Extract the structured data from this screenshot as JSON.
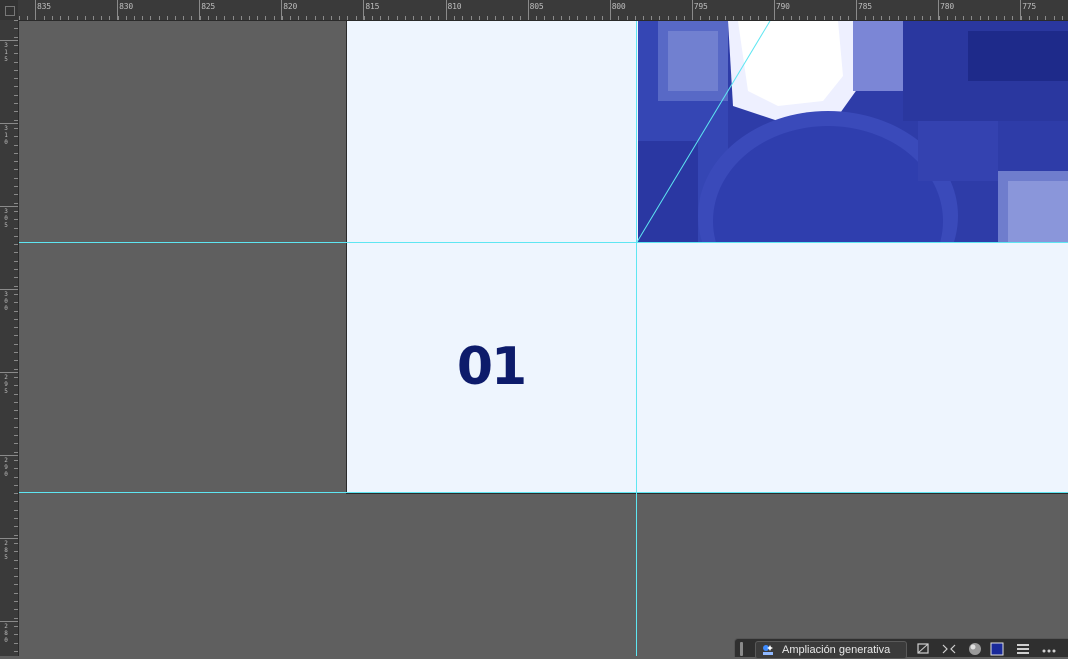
{
  "ruler": {
    "top_labels": [
      "835",
      "830",
      "825",
      "820",
      "815",
      "810",
      "805",
      "800",
      "795",
      "790",
      "785",
      "780",
      "775"
    ],
    "left_labels": [
      "315",
      "310",
      "305",
      "300",
      "295",
      "290",
      "285",
      "280"
    ]
  },
  "artboard": {
    "number_text": "01",
    "number_color": "#0d1b6b",
    "background": "#eef5fe"
  },
  "colors": {
    "canvas": "#5f5f5f",
    "guide": "#5ee6f2",
    "photo_tint": "#2c3aa7"
  },
  "toolbar": {
    "generative_expand_label": "Ampliación generativa",
    "icons": [
      "generative-expand-icon",
      "crop-icon",
      "transform-icon",
      "sphere-icon",
      "color-swatch-icon",
      "menu-icon",
      "more-icon"
    ],
    "swatch_color": "#1a2a9a"
  }
}
